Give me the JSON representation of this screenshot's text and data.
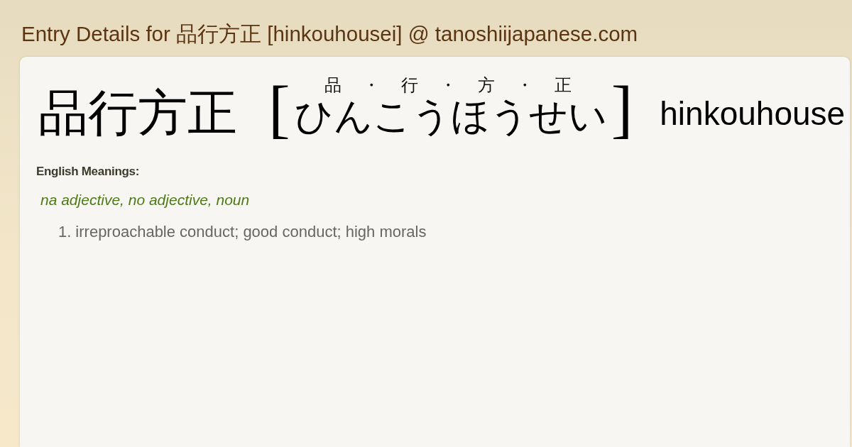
{
  "page_title": "Entry Details for 品行方正 [hinkouhousei] @ tanoshiijapanese.com",
  "entry": {
    "headword": "品行方正",
    "open_bracket": "[",
    "furigana": [
      "品",
      "・",
      "行",
      "・",
      "方",
      "・",
      "正"
    ],
    "kana": "ひんこうほうせい",
    "close_bracket": "]",
    "romaji": "hinkouhouse"
  },
  "meanings": {
    "heading": "English Meanings:",
    "part_of_speech": "na adjective, no adjective, noun",
    "senses": [
      {
        "number": "1.",
        "text": "irreproachable conduct; good conduct; high morals"
      }
    ]
  }
}
